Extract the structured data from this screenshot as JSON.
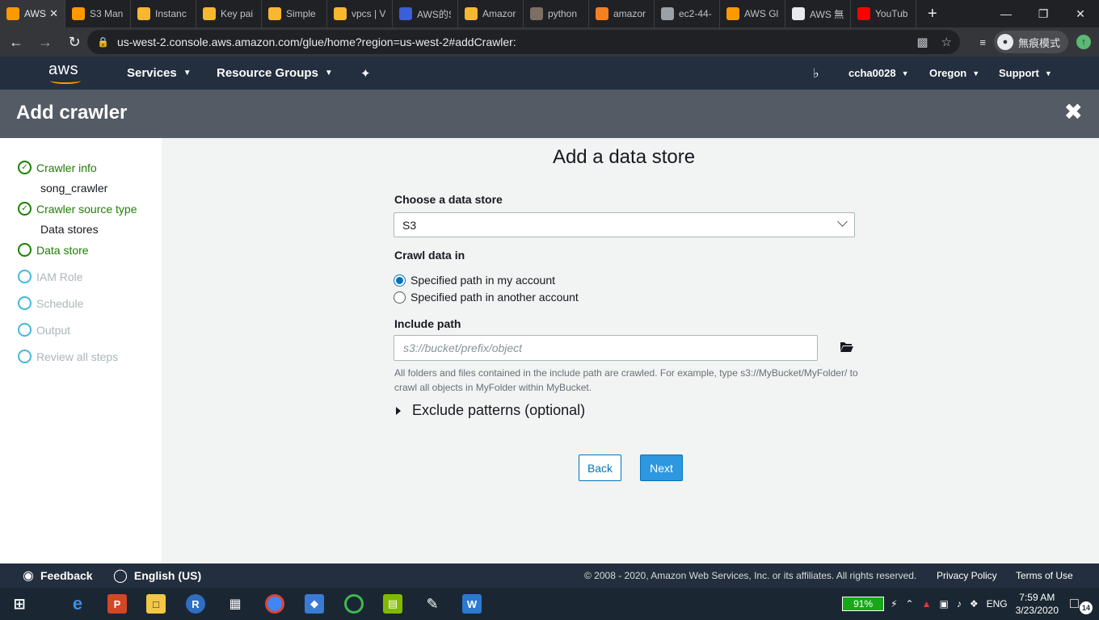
{
  "browser": {
    "tabs": [
      {
        "label": "AWS",
        "color": "#ff9900",
        "active": true
      },
      {
        "label": "S3 Man",
        "color": "#ff9900"
      },
      {
        "label": "Instanc",
        "color": "#f7b731"
      },
      {
        "label": "Key pai",
        "color": "#f7b731"
      },
      {
        "label": "Simple",
        "color": "#f7b731"
      },
      {
        "label": "vpcs | V",
        "color": "#f7b731"
      },
      {
        "label": "AWS的S",
        "color": "#3b5fd6"
      },
      {
        "label": "Amazor",
        "color": "#f7b731"
      },
      {
        "label": "python",
        "color": "#7c6f64"
      },
      {
        "label": "amazor",
        "color": "#f48024"
      },
      {
        "label": "ec2-44-",
        "color": "#9aa0a6"
      },
      {
        "label": "AWS Gl",
        "color": "#ff9900"
      },
      {
        "label": "AWS 無",
        "color": "#e8eaed"
      },
      {
        "label": "YouTub",
        "color": "#ff0000"
      }
    ],
    "new_tab": "+",
    "url": "us-west-2.console.aws.amazon.com/glue/home?region=us-west-2#addCrawler:",
    "incognito_label": "無痕模式"
  },
  "awsnav": {
    "logo": "aws",
    "services": "Services",
    "resource_groups": "Resource Groups",
    "user": "ccha0028",
    "region": "Oregon",
    "support": "Support"
  },
  "page": {
    "title": "Add crawler"
  },
  "sidebar": {
    "steps": [
      {
        "label": "Crawler info",
        "state": "done",
        "value": "song_crawler"
      },
      {
        "label": "Crawler source type",
        "state": "done",
        "value": "Data stores"
      },
      {
        "label": "Data store",
        "state": "current"
      },
      {
        "label": "IAM Role",
        "state": "todo"
      },
      {
        "label": "Schedule",
        "state": "todo"
      },
      {
        "label": "Output",
        "state": "todo"
      },
      {
        "label": "Review all steps",
        "state": "todo"
      }
    ]
  },
  "form": {
    "heading": "Add a data store",
    "choose_label": "Choose a data store",
    "data_store_value": "S3",
    "crawl_label": "Crawl data in",
    "radio_my_account": "Specified path in my account",
    "radio_other_account": "Specified path in another account",
    "include_label": "Include path",
    "include_placeholder": "s3://bucket/prefix/object",
    "include_help": "All folders and files contained in the include path are crawled. For example, type s3://MyBucket/MyFolder/ to crawl all objects in MyFolder within MyBucket.",
    "exclude_label": "Exclude patterns (optional)",
    "back_label": "Back",
    "next_label": "Next"
  },
  "footer": {
    "feedback": "Feedback",
    "language": "English (US)",
    "copyright": "© 2008 - 2020, Amazon Web Services, Inc. or its affiliates. All rights reserved.",
    "privacy": "Privacy Policy",
    "terms": "Terms of Use"
  },
  "taskbar": {
    "battery": "91%",
    "language": "ENG",
    "time": "7:59 AM",
    "date": "3/23/2020",
    "notifications": "14"
  },
  "colors": {
    "aws_nav": "#232f3e",
    "aws_orange": "#ff9900",
    "success_green": "#1d8102",
    "primary_blue": "#0073bb"
  }
}
